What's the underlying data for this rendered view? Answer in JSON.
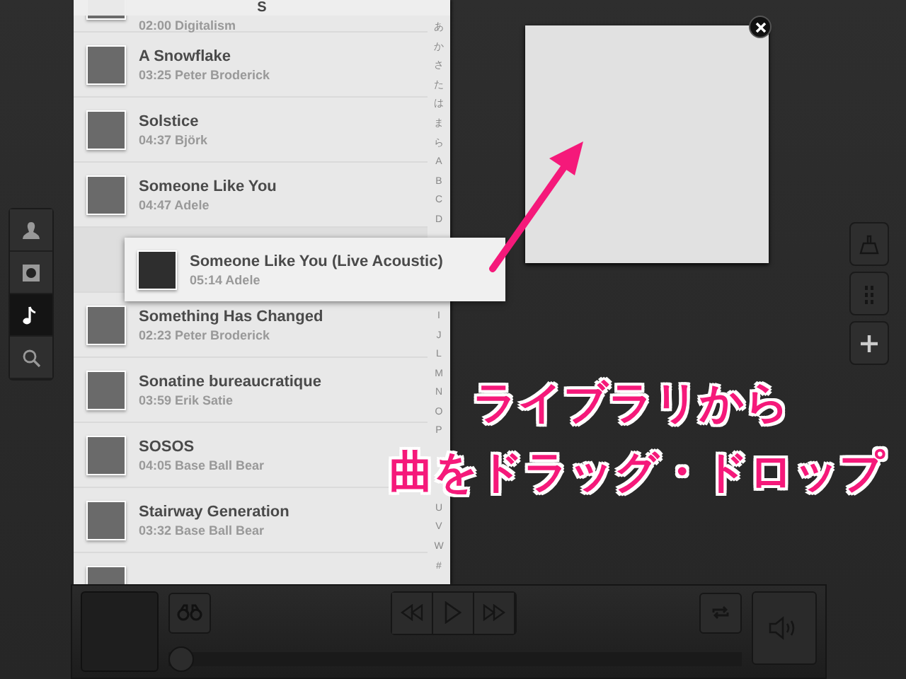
{
  "library": {
    "section_header": "S",
    "rows": [
      {
        "kind": "song",
        "subtitle": "02:00 Digitalism"
      },
      {
        "kind": "song",
        "title": "A Snowflake",
        "subtitle": "03:25 Peter Broderick"
      },
      {
        "kind": "song",
        "title": "Solstice",
        "subtitle": "04:37 Björk"
      },
      {
        "kind": "song",
        "title": "Someone Like You",
        "subtitle": "04:47 Adele"
      },
      {
        "kind": "drop_gap"
      },
      {
        "kind": "song",
        "title": "Something Has Changed",
        "subtitle": "02:23 Peter Broderick"
      },
      {
        "kind": "song",
        "title": "Sonatine bureaucratique",
        "subtitle": "03:59 Erik Satie"
      },
      {
        "kind": "song",
        "title": "SOSOS",
        "subtitle": "04:05 Base Ball Bear"
      },
      {
        "kind": "song",
        "title": "Stairway Generation",
        "subtitle": "03:32 Base Ball Bear"
      },
      {
        "kind": "song"
      }
    ],
    "index": [
      [
        "あ",
        "か",
        "さ",
        "た",
        "は",
        "ま",
        "ら",
        "A",
        "B",
        "C",
        "D"
      ],
      [
        "I",
        "J",
        "L",
        "M",
        "N",
        "O",
        "P"
      ],
      [
        "U",
        "V",
        "W",
        "#"
      ]
    ]
  },
  "dragged_song": {
    "title": "Someone Like You (Live Acoustic)",
    "subtitle": "05:14 Adele"
  },
  "left_rail": [
    {
      "selected": false
    },
    {
      "selected": false
    },
    {
      "selected": true
    },
    {
      "selected": false
    }
  ],
  "annotation": [
    "ライブラリから",
    "曲をドラッグ・ドロップ"
  ],
  "player": {
    "level": 0
  }
}
